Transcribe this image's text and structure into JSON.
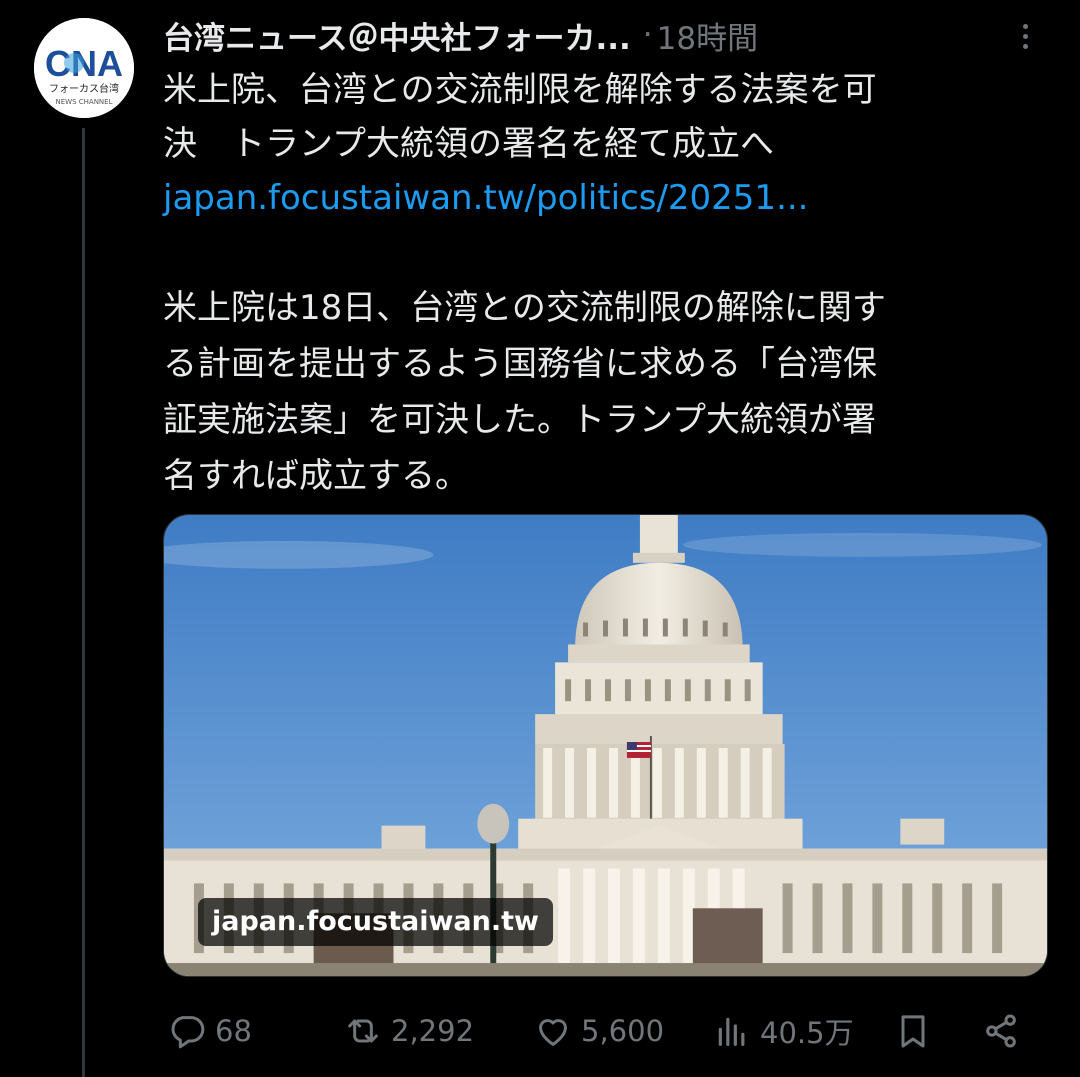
{
  "account": {
    "avatar_text": "CNA",
    "avatar_sub": "フォーカス台湾",
    "avatar_sub2": "NEWS CHANNEL",
    "display_name": "台湾ニュース＠中央社フォーカ...",
    "separator": "·",
    "timestamp": "18時間"
  },
  "tweet": {
    "headline_line1": "米上院、台湾との交流制限を解除する法案を可",
    "headline_line2": "決　トランプ大統領の署名を経て成立へ",
    "link": "japan.focustaiwan.tw/politics/20251...",
    "body_lines": [
      "米上院は18日、台湾との交流制限の解除に関す",
      "る計画を提出するよう国務省に求める「台湾保",
      "証実施法案」を可決した。トランプ大統領が署",
      "名すれば成立する。"
    ]
  },
  "media": {
    "domain": "japan.focustaiwan.tw",
    "sky_color": "#4a86c9",
    "building_color": "#e8e2d6"
  },
  "actions": {
    "replies": "68",
    "reposts": "2,292",
    "likes": "5,600",
    "views": "40.5万"
  },
  "colors": {
    "background": "#000000",
    "text": "#e7e9ea",
    "muted": "#71767b",
    "link": "#1d9bf0"
  }
}
